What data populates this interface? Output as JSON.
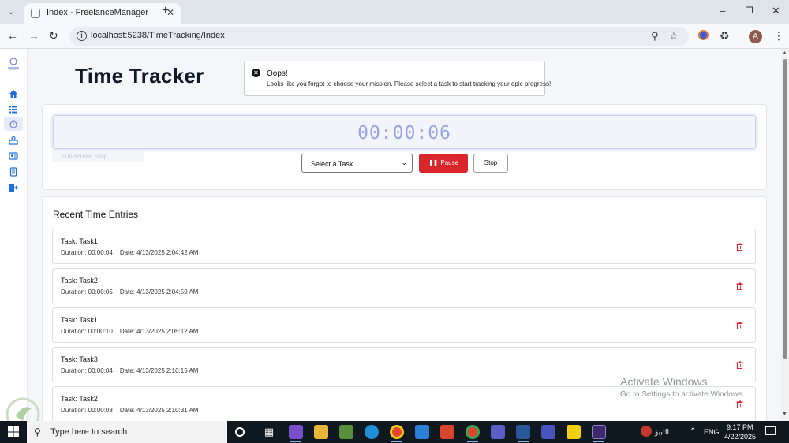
{
  "browser": {
    "tab_title": "Index - FreelanceManager",
    "url": "localhost:5238/TimeTracking/Index",
    "profile_initial": "A"
  },
  "page": {
    "title": "Time Tracker",
    "alert": {
      "title": "Oops!",
      "message": "Looks like you forgot to choose your mission. Please select a task to start tracking your epic progress!"
    },
    "timer": {
      "display": "00:00:06",
      "fullscreen_hint": "Full-screen Stop",
      "select_placeholder": "Select a Task",
      "pause_label": "Pause",
      "stop_label": "Stop"
    },
    "entries_title": "Recent Time Entries",
    "entries": [
      {
        "task": "Task: Task1",
        "duration": "Duration: 00:00:04",
        "date": "Date: 4/13/2025 2:04:42 AM"
      },
      {
        "task": "Task: Task2",
        "duration": "Duration: 00:00:05",
        "date": "Date: 4/13/2025 2:04:59 AM"
      },
      {
        "task": "Task: Task1",
        "duration": "Duration: 00:00:10",
        "date": "Date: 4/13/2025 2:05:12 AM"
      },
      {
        "task": "Task: Task3",
        "duration": "Duration: 00:00:04",
        "date": "Date: 4/13/2025 2:10:15 AM"
      },
      {
        "task": "Task: Task2",
        "duration": "Duration: 00:00:08",
        "date": "Date: 4/13/2025 2:10:31 AM"
      }
    ]
  },
  "watermark": {
    "line1": "Activate Windows",
    "line2": "Go to Settings to activate Windows."
  },
  "taskbar": {
    "search_placeholder": "Type here to search",
    "weather_text": "التبيؤ...",
    "language": "ENG",
    "time": "9:17 PM",
    "date": "4/22/2025"
  },
  "colors": {
    "accent_blue": "#1e6fd9",
    "danger_red": "#d9262b",
    "timer_text": "#98a4e6"
  }
}
